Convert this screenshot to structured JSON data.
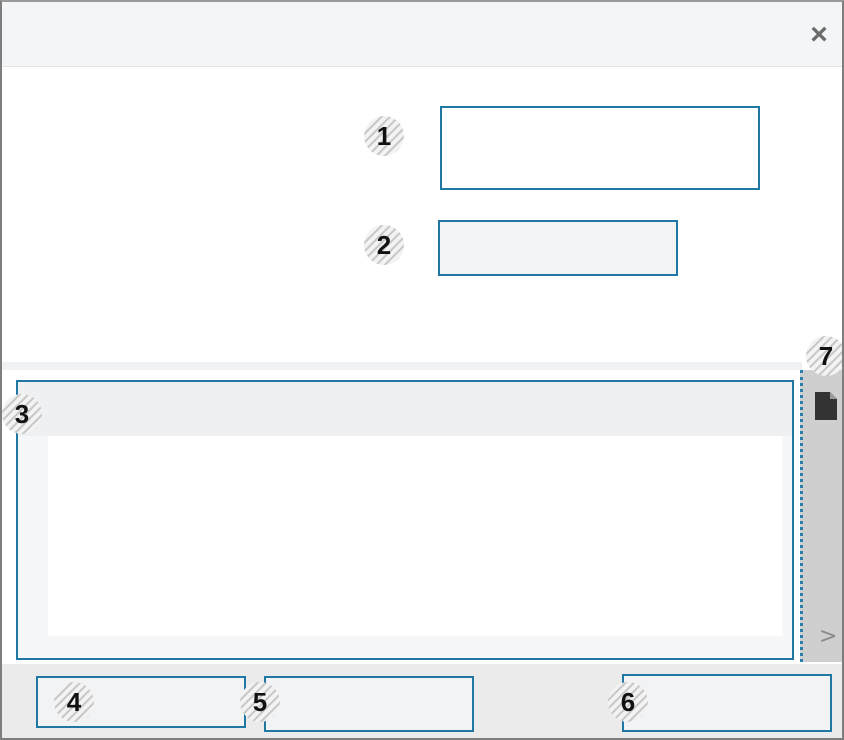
{
  "close_glyph": "×",
  "callouts": {
    "c1": "1",
    "c2": "2",
    "c3": "3",
    "c4": "4",
    "c5": "5",
    "c6": "6",
    "c7": "7"
  },
  "side_panel": {
    "chevron": ">"
  },
  "colors": {
    "accent": "#1f77a3",
    "side_panel": "#cfcfcf",
    "footer": "#ebebeb"
  },
  "icons": [
    "close-icon",
    "document-icon",
    "chevron-right-icon"
  ]
}
